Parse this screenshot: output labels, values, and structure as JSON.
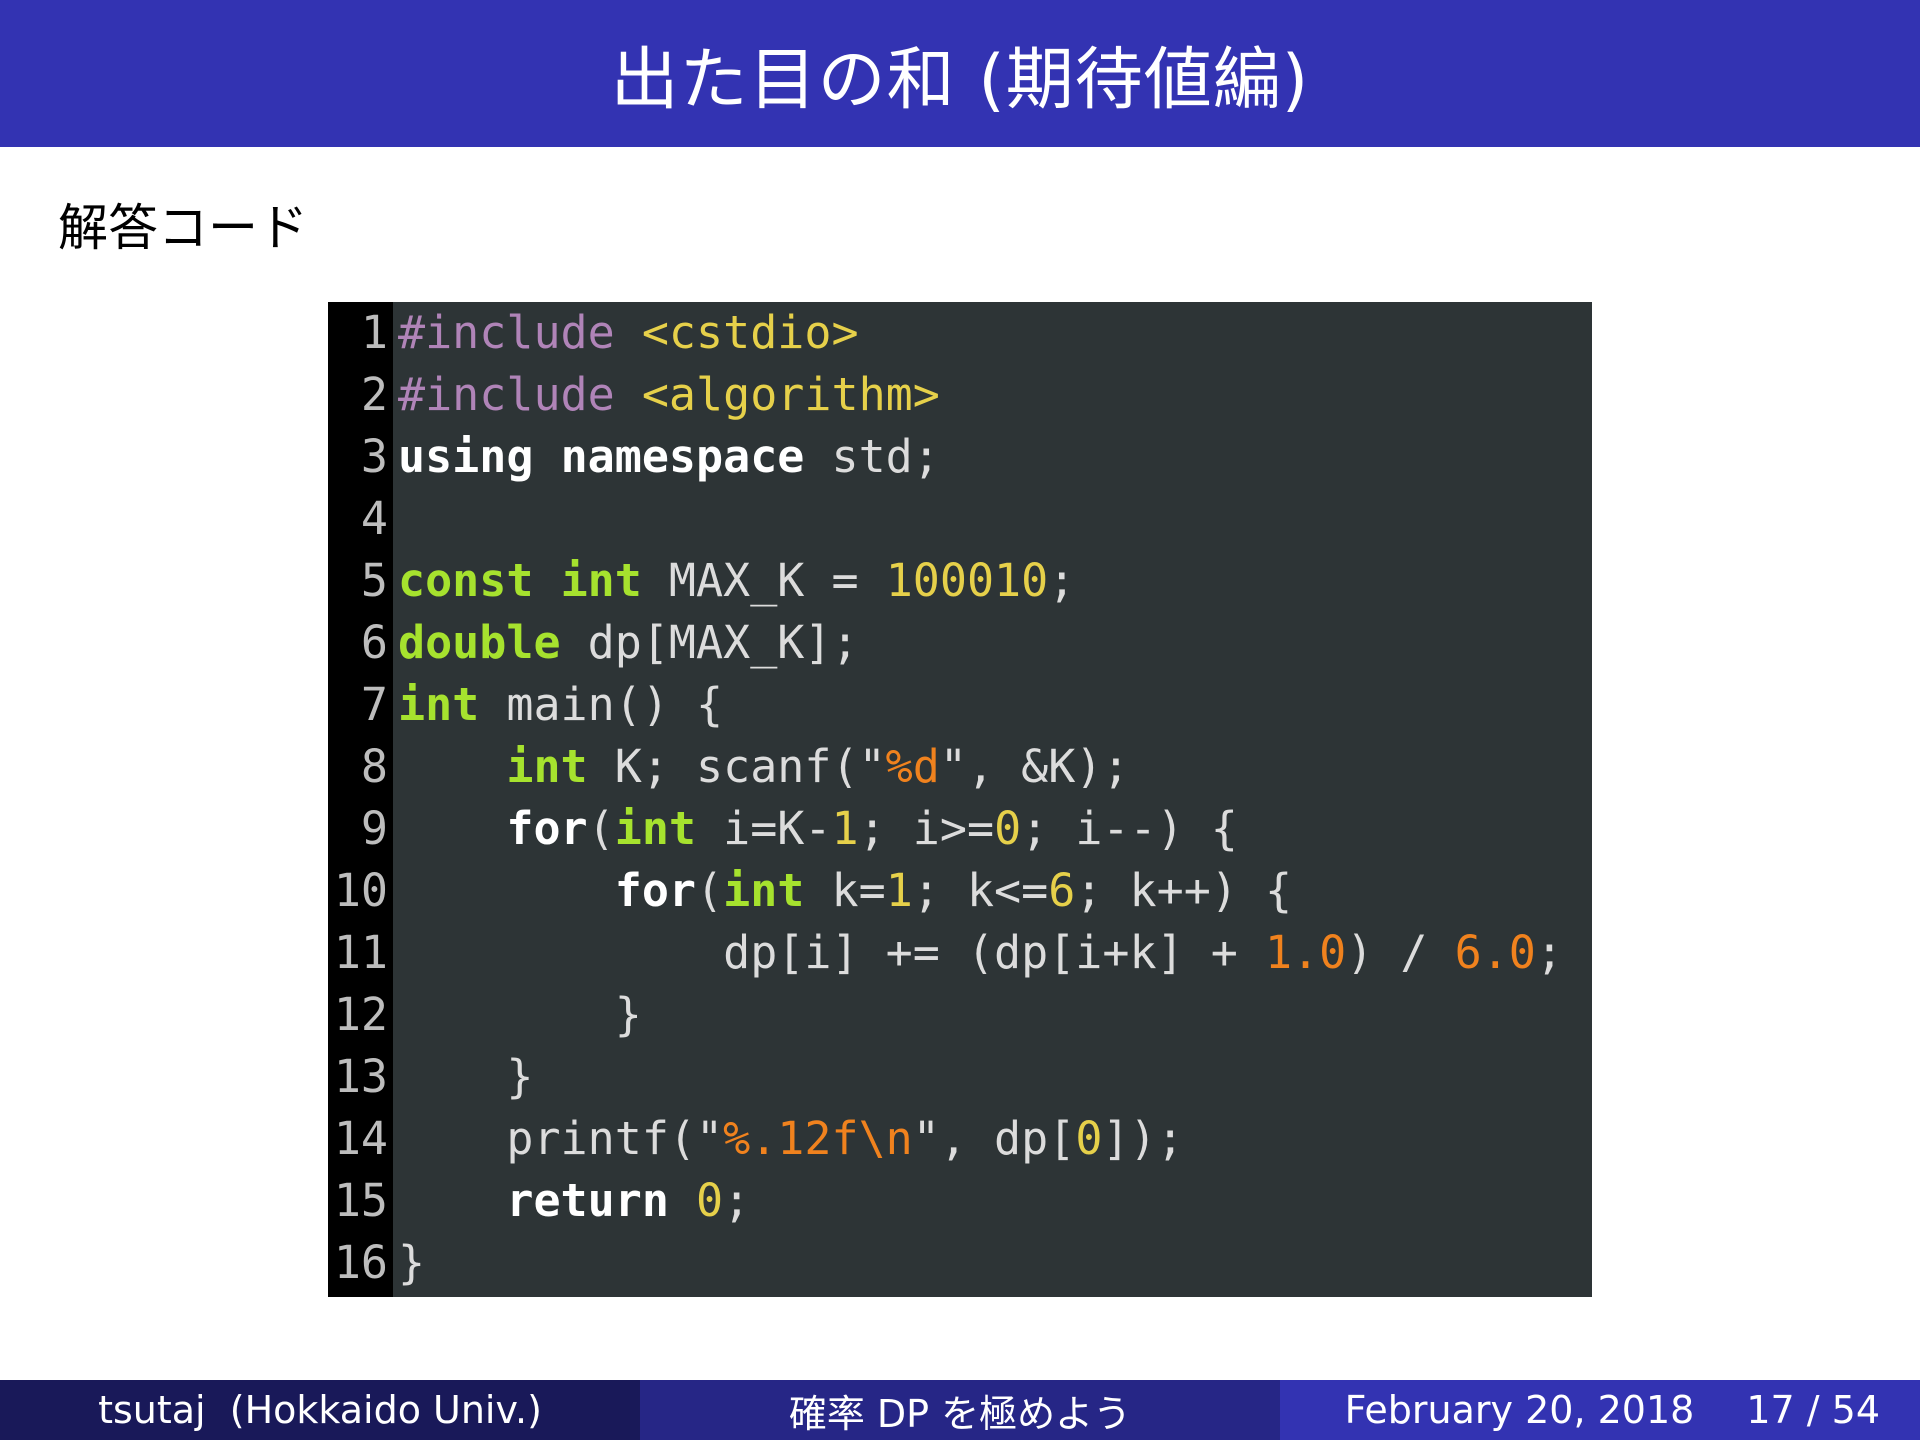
{
  "slide": {
    "title": "出た目の和 (期待値編)",
    "subtitle": "解答コード"
  },
  "colors": {
    "title_bar": "#3333b2",
    "footer_left": "#191959",
    "footer_mid": "#262686",
    "footer_right": "#3333b2",
    "code_background": "#2d3436",
    "gutter_background": "#000000"
  },
  "code": {
    "lines": [
      {
        "num": "1",
        "tokens": [
          {
            "t": "#include ",
            "c": "pre"
          },
          {
            "t": "<cstdio>",
            "c": "inc"
          }
        ]
      },
      {
        "num": "2",
        "tokens": [
          {
            "t": "#include ",
            "c": "pre"
          },
          {
            "t": "<algorithm>",
            "c": "inc"
          }
        ]
      },
      {
        "num": "3",
        "tokens": [
          {
            "t": "using",
            "c": "kw"
          },
          {
            "t": " ",
            "c": "plain"
          },
          {
            "t": "namespace",
            "c": "kw"
          },
          {
            "t": " std;",
            "c": "plain"
          }
        ]
      },
      {
        "num": "4",
        "tokens": []
      },
      {
        "num": "5",
        "tokens": [
          {
            "t": "const",
            "c": "type"
          },
          {
            "t": " ",
            "c": "plain"
          },
          {
            "t": "int",
            "c": "type"
          },
          {
            "t": " MAX_K = ",
            "c": "plain"
          },
          {
            "t": "100010",
            "c": "num"
          },
          {
            "t": ";",
            "c": "plain"
          }
        ]
      },
      {
        "num": "6",
        "tokens": [
          {
            "t": "double",
            "c": "type"
          },
          {
            "t": " dp[MAX_K];",
            "c": "plain"
          }
        ]
      },
      {
        "num": "7",
        "tokens": [
          {
            "t": "int",
            "c": "type"
          },
          {
            "t": " main() {",
            "c": "plain"
          }
        ]
      },
      {
        "num": "8",
        "tokens": [
          {
            "t": "    ",
            "c": "plain"
          },
          {
            "t": "int",
            "c": "type"
          },
          {
            "t": " K; scanf(\"",
            "c": "plain"
          },
          {
            "t": "%d",
            "c": "str"
          },
          {
            "t": "\", &K);",
            "c": "plain"
          }
        ]
      },
      {
        "num": "9",
        "tokens": [
          {
            "t": "    ",
            "c": "plain"
          },
          {
            "t": "for",
            "c": "kw"
          },
          {
            "t": "(",
            "c": "plain"
          },
          {
            "t": "int",
            "c": "type"
          },
          {
            "t": " i=K-",
            "c": "plain"
          },
          {
            "t": "1",
            "c": "num"
          },
          {
            "t": "; i>=",
            "c": "plain"
          },
          {
            "t": "0",
            "c": "num"
          },
          {
            "t": "; i--) {",
            "c": "plain"
          }
        ]
      },
      {
        "num": "10",
        "tokens": [
          {
            "t": "        ",
            "c": "plain"
          },
          {
            "t": "for",
            "c": "kw"
          },
          {
            "t": "(",
            "c": "plain"
          },
          {
            "t": "int",
            "c": "type"
          },
          {
            "t": " k=",
            "c": "plain"
          },
          {
            "t": "1",
            "c": "num"
          },
          {
            "t": "; k<=",
            "c": "plain"
          },
          {
            "t": "6",
            "c": "num"
          },
          {
            "t": "; k++) {",
            "c": "plain"
          }
        ]
      },
      {
        "num": "11",
        "tokens": [
          {
            "t": "            dp[i] += (dp[i+k] + ",
            "c": "plain"
          },
          {
            "t": "1.0",
            "c": "flt"
          },
          {
            "t": ") / ",
            "c": "plain"
          },
          {
            "t": "6.0",
            "c": "flt"
          },
          {
            "t": ";",
            "c": "plain"
          }
        ]
      },
      {
        "num": "12",
        "tokens": [
          {
            "t": "        }",
            "c": "plain"
          }
        ]
      },
      {
        "num": "13",
        "tokens": [
          {
            "t": "    }",
            "c": "plain"
          }
        ]
      },
      {
        "num": "14",
        "tokens": [
          {
            "t": "    printf(\"",
            "c": "plain"
          },
          {
            "t": "%.12f\\n",
            "c": "str"
          },
          {
            "t": "\", dp[",
            "c": "plain"
          },
          {
            "t": "0",
            "c": "num"
          },
          {
            "t": "]);",
            "c": "plain"
          }
        ]
      },
      {
        "num": "15",
        "tokens": [
          {
            "t": "    ",
            "c": "plain"
          },
          {
            "t": "return",
            "c": "kw"
          },
          {
            "t": " ",
            "c": "plain"
          },
          {
            "t": "0",
            "c": "num"
          },
          {
            "t": ";",
            "c": "plain"
          }
        ]
      },
      {
        "num": "16",
        "tokens": [
          {
            "t": "}",
            "c": "plain"
          }
        ]
      }
    ]
  },
  "footer": {
    "author": "tsutaj  (Hokkaido Univ.)",
    "talk_title": "確率 DP を極めよう",
    "date": "February 20, 2018",
    "page": "17 / 54"
  }
}
